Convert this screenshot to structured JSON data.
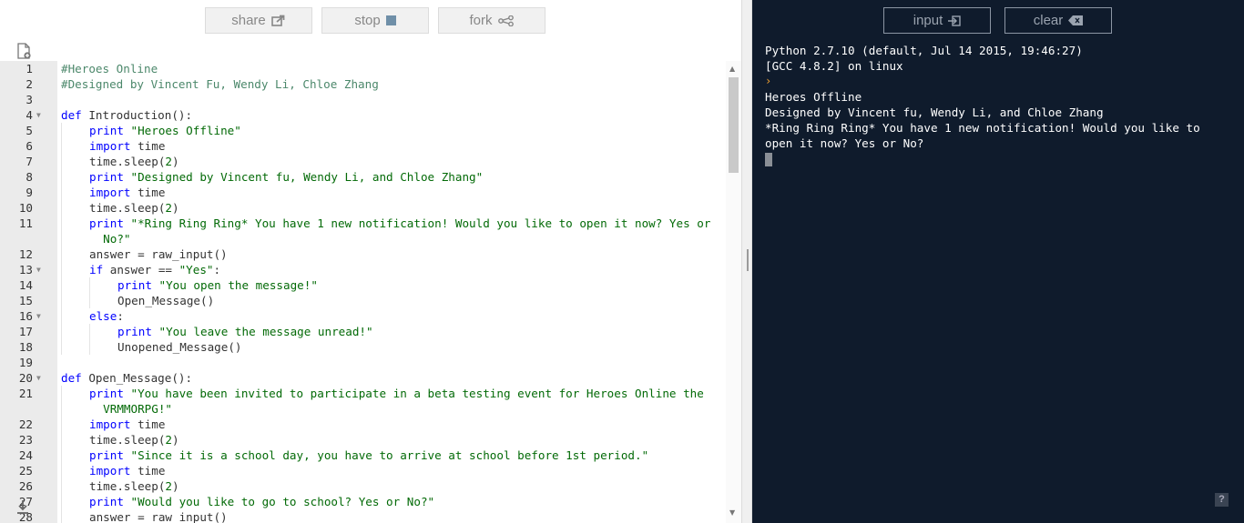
{
  "toolbar": {
    "share_label": "share",
    "stop_label": "stop",
    "fork_label": "fork"
  },
  "console_toolbar": {
    "input_label": "input",
    "clear_label": "clear"
  },
  "editor": {
    "lines": [
      {
        "n": "1",
        "fold": false,
        "indent": 0,
        "tokens": [
          [
            "cmt",
            "#Heroes Online"
          ]
        ]
      },
      {
        "n": "2",
        "fold": false,
        "indent": 0,
        "tokens": [
          [
            "cmt",
            "#Designed by Vincent Fu, Wendy Li, Chloe Zhang"
          ]
        ]
      },
      {
        "n": "3",
        "fold": false,
        "indent": 0,
        "tokens": []
      },
      {
        "n": "4",
        "fold": true,
        "indent": 0,
        "tokens": [
          [
            "kw",
            "def"
          ],
          [
            "txt",
            " Introduction():"
          ]
        ]
      },
      {
        "n": "5",
        "fold": false,
        "indent": 1,
        "tokens": [
          [
            "kw",
            "print"
          ],
          [
            "txt",
            " "
          ],
          [
            "str",
            "\"Heroes Offline\""
          ]
        ]
      },
      {
        "n": "6",
        "fold": false,
        "indent": 1,
        "tokens": [
          [
            "kw",
            "import"
          ],
          [
            "txt",
            " time"
          ]
        ]
      },
      {
        "n": "7",
        "fold": false,
        "indent": 1,
        "tokens": [
          [
            "txt",
            "time.sleep("
          ],
          [
            "str",
            "2"
          ],
          [
            "txt",
            ")"
          ]
        ]
      },
      {
        "n": "8",
        "fold": false,
        "indent": 1,
        "tokens": [
          [
            "kw",
            "print"
          ],
          [
            "txt",
            " "
          ],
          [
            "str",
            "\"Designed by Vincent fu, Wendy Li, and Chloe Zhang\""
          ]
        ]
      },
      {
        "n": "9",
        "fold": false,
        "indent": 1,
        "tokens": [
          [
            "kw",
            "import"
          ],
          [
            "txt",
            " time"
          ]
        ]
      },
      {
        "n": "10",
        "fold": false,
        "indent": 1,
        "tokens": [
          [
            "txt",
            "time.sleep("
          ],
          [
            "str",
            "2"
          ],
          [
            "txt",
            ")"
          ]
        ]
      },
      {
        "n": "11",
        "fold": false,
        "indent": 1,
        "tokens": [
          [
            "kw",
            "print"
          ],
          [
            "txt",
            " "
          ],
          [
            "str",
            "\"*Ring Ring Ring* You have 1 new notification! Would you like to open it now? Yes or"
          ]
        ]
      },
      {
        "n": "",
        "fold": false,
        "indent": 1,
        "wrap": true,
        "tokens": [
          [
            "str",
            "  No?\""
          ]
        ]
      },
      {
        "n": "12",
        "fold": false,
        "indent": 1,
        "tokens": [
          [
            "txt",
            "answer = raw_input()"
          ]
        ]
      },
      {
        "n": "13",
        "fold": true,
        "indent": 1,
        "tokens": [
          [
            "kw",
            "if"
          ],
          [
            "txt",
            " answer == "
          ],
          [
            "str",
            "\"Yes\""
          ],
          [
            "txt",
            ":"
          ]
        ]
      },
      {
        "n": "14",
        "fold": false,
        "indent": 2,
        "tokens": [
          [
            "kw",
            "print"
          ],
          [
            "txt",
            " "
          ],
          [
            "str",
            "\"You open the message!\""
          ]
        ]
      },
      {
        "n": "15",
        "fold": false,
        "indent": 2,
        "tokens": [
          [
            "txt",
            "Open_Message()"
          ]
        ]
      },
      {
        "n": "16",
        "fold": true,
        "indent": 1,
        "tokens": [
          [
            "kw",
            "else"
          ],
          [
            "txt",
            ":"
          ]
        ]
      },
      {
        "n": "17",
        "fold": false,
        "indent": 2,
        "tokens": [
          [
            "kw",
            "print"
          ],
          [
            "txt",
            " "
          ],
          [
            "str",
            "\"You leave the message unread!\""
          ]
        ]
      },
      {
        "n": "18",
        "fold": false,
        "indent": 2,
        "tokens": [
          [
            "txt",
            "Unopened_Message()"
          ]
        ]
      },
      {
        "n": "19",
        "fold": false,
        "indent": 0,
        "tokens": []
      },
      {
        "n": "20",
        "fold": true,
        "indent": 0,
        "tokens": [
          [
            "kw",
            "def"
          ],
          [
            "txt",
            " Open_Message():"
          ]
        ]
      },
      {
        "n": "21",
        "fold": false,
        "indent": 1,
        "tokens": [
          [
            "kw",
            "print"
          ],
          [
            "txt",
            " "
          ],
          [
            "str",
            "\"You have been invited to participate in a beta testing event for Heroes Online the"
          ]
        ]
      },
      {
        "n": "",
        "fold": false,
        "indent": 1,
        "wrap": true,
        "tokens": [
          [
            "str",
            "  VRMMORPG!\""
          ]
        ]
      },
      {
        "n": "22",
        "fold": false,
        "indent": 1,
        "tokens": [
          [
            "kw",
            "import"
          ],
          [
            "txt",
            " time"
          ]
        ]
      },
      {
        "n": "23",
        "fold": false,
        "indent": 1,
        "tokens": [
          [
            "txt",
            "time.sleep("
          ],
          [
            "str",
            "2"
          ],
          [
            "txt",
            ")"
          ]
        ]
      },
      {
        "n": "24",
        "fold": false,
        "indent": 1,
        "tokens": [
          [
            "kw",
            "print"
          ],
          [
            "txt",
            " "
          ],
          [
            "str",
            "\"Since it is a school day, you have to arrive at school before 1st period.\""
          ]
        ]
      },
      {
        "n": "25",
        "fold": false,
        "indent": 1,
        "tokens": [
          [
            "kw",
            "import"
          ],
          [
            "txt",
            " time"
          ]
        ]
      },
      {
        "n": "26",
        "fold": false,
        "indent": 1,
        "tokens": [
          [
            "txt",
            "time.sleep("
          ],
          [
            "str",
            "2"
          ],
          [
            "txt",
            ")"
          ]
        ]
      },
      {
        "n": "27",
        "fold": false,
        "indent": 1,
        "tokens": [
          [
            "kw",
            "print"
          ],
          [
            "txt",
            " "
          ],
          [
            "str",
            "\"Would you like to go to school? Yes or No?\""
          ]
        ]
      },
      {
        "n": "28",
        "fold": false,
        "indent": 1,
        "tokens": [
          [
            "txt",
            "answer = raw_input()"
          ]
        ]
      }
    ]
  },
  "console": {
    "header_lines": [
      "Python 2.7.10 (default, Jul 14 2015, 19:46:27)",
      "[GCC 4.8.2] on linux"
    ],
    "prompt": "›",
    "output_lines": [
      "Heroes Offline",
      "Designed by Vincent fu, Wendy Li, and Chloe Zhang",
      "*Ring Ring Ring* You have 1 new notification! Would you like to open it now? Yes or No?"
    ],
    "help_label": "?"
  },
  "colors": {
    "keyword": "#0000ff",
    "string": "#036a07",
    "comment": "#4c886b",
    "console_bg": "#0f1b2c"
  },
  "icons": [
    "share-icon",
    "stop-icon",
    "fork-icon",
    "input-icon",
    "clear-icon",
    "new-file-icon",
    "download-icon",
    "help-icon"
  ]
}
